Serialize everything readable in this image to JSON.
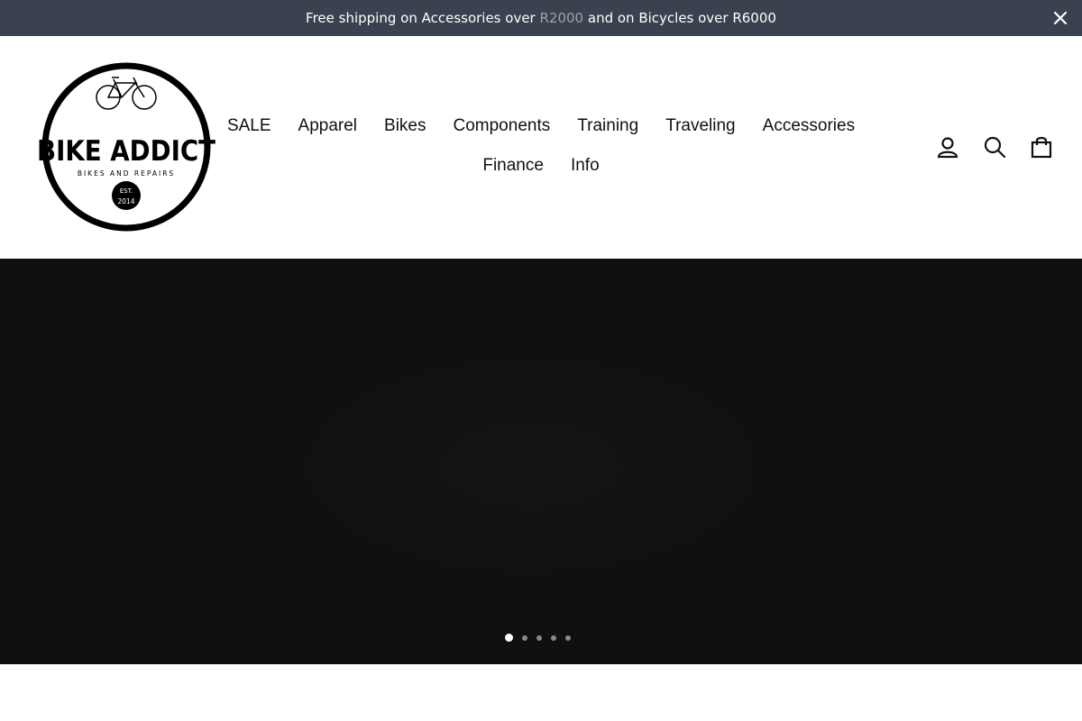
{
  "announcement": {
    "text_before": "Free shipping on Accessories over ",
    "highlight": "R2000",
    "text_after": " and on Bicycles over R6000",
    "close_icon": "close-icon"
  },
  "logo": {
    "brand": "BIKE ADDICT",
    "tagline": "BIKES AND REPAIRS",
    "est_line1": "EST.",
    "est_line2": "2014"
  },
  "nav": {
    "row1": [
      "SALE",
      "Apparel",
      "Bikes",
      "Components",
      "Training",
      "Traveling",
      "Accessories"
    ],
    "row2": [
      "Finance",
      "Info"
    ]
  },
  "header_icons": [
    "account-icon",
    "search-icon",
    "cart-icon"
  ],
  "slideshow": {
    "slides_count": 5,
    "active_index": 0
  },
  "colors": {
    "announcement_bg": "#3a4250",
    "highlight": "#9aa3a8",
    "hero_bg": "#0f0f0f"
  }
}
